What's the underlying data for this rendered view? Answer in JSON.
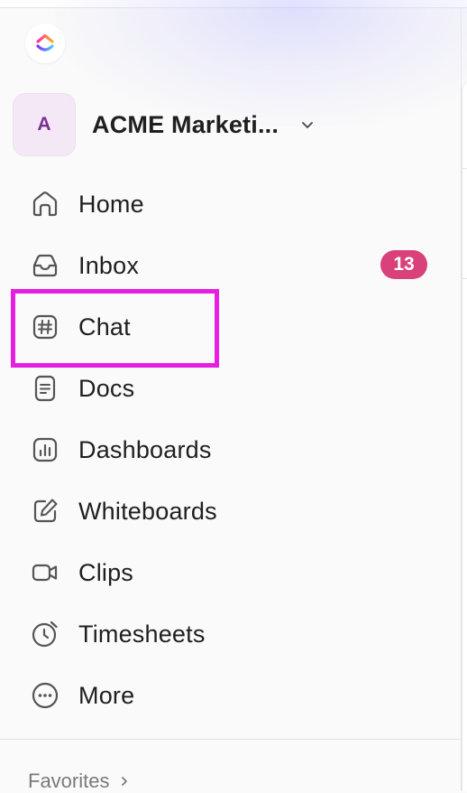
{
  "colors": {
    "accent": "#e61ee0",
    "badge": "#d8417a",
    "avatar_bg": "#f4e8f6",
    "avatar_text": "#7a2f8f",
    "icon": "#555555"
  },
  "logo": {
    "icon": "clickup-logo-icon"
  },
  "workspace": {
    "avatar_letter": "A",
    "name": "ACME Marketi...",
    "chevron_icon": "chevron-down-icon"
  },
  "nav": {
    "items": [
      {
        "label": "Home",
        "icon": "home-icon"
      },
      {
        "label": "Inbox",
        "icon": "inbox-icon",
        "badge": "13"
      },
      {
        "label": "Chat",
        "icon": "hash-icon"
      },
      {
        "label": "Docs",
        "icon": "doc-icon"
      },
      {
        "label": "Dashboards",
        "icon": "dashboard-icon"
      },
      {
        "label": "Whiteboards",
        "icon": "whiteboard-icon"
      },
      {
        "label": "Clips",
        "icon": "video-icon"
      },
      {
        "label": "Timesheets",
        "icon": "clock-icon"
      },
      {
        "label": "More",
        "icon": "more-icon"
      }
    ]
  },
  "favorites": {
    "label": "Favorites",
    "chevron_icon": "chevron-right-icon"
  }
}
